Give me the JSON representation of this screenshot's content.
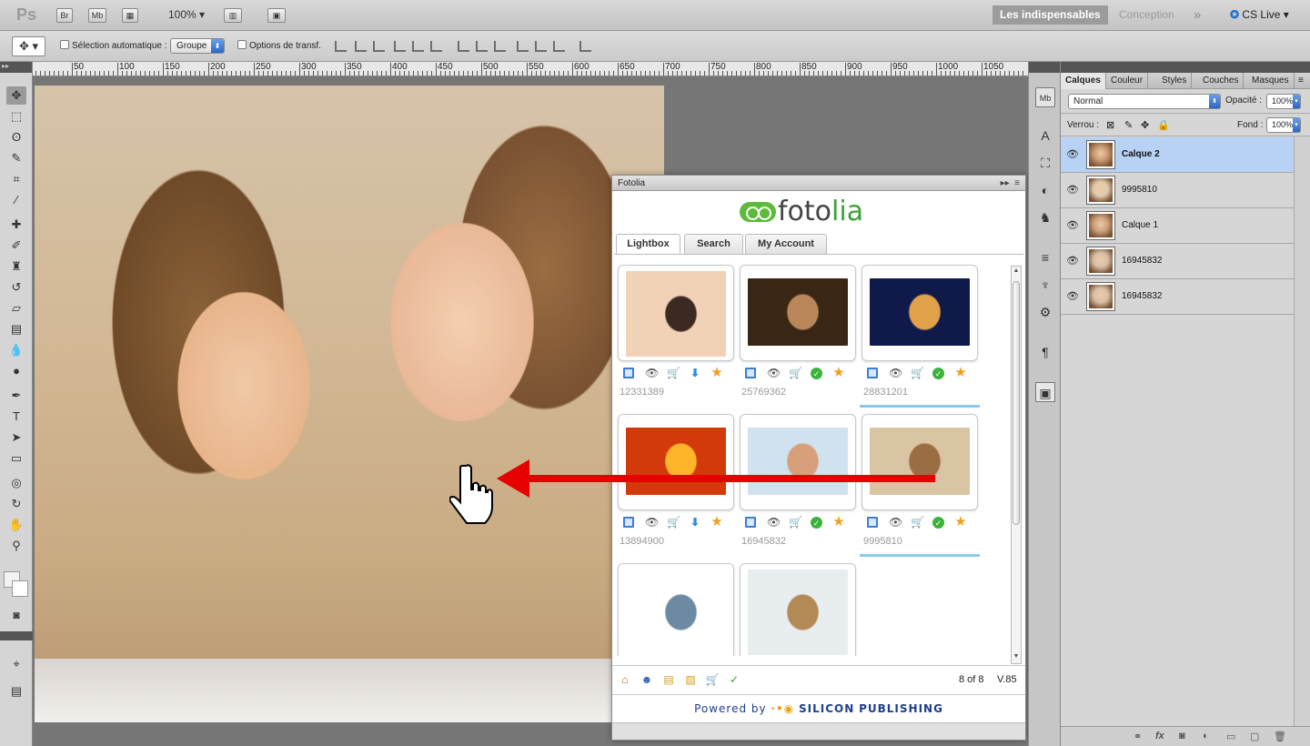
{
  "appbar": {
    "logo": "Ps",
    "br": "Br",
    "mb": "Mb",
    "zoom": "100%",
    "workspace_active": "Les indispensables",
    "workspace_other": "Conception",
    "more": "»",
    "cs_live": "CS Live"
  },
  "options": {
    "auto_select_label": "Sélection automatique :",
    "auto_select_value": "Groupe",
    "transform_label": "Options de transf."
  },
  "ruler": [
    "50",
    "100",
    "150",
    "200",
    "250",
    "300",
    "350",
    "400",
    "450",
    "500",
    "550",
    "600",
    "650",
    "700",
    "750",
    "800",
    "850",
    "900",
    "950",
    "1000",
    "1050"
  ],
  "fotolia": {
    "panel_title": "Fotolia",
    "logo_left": "foto",
    "logo_right": "lia",
    "tabs": [
      "Lightbox",
      "Search",
      "My Account"
    ],
    "items": [
      {
        "id": "12331389",
        "icons": [
          "blue",
          "eye",
          "cart",
          "dl",
          "star"
        ],
        "colors": [
          "#f1d2b6",
          "#3b2a22"
        ],
        "selected": false
      },
      {
        "id": "25769362",
        "icons": [
          "blue",
          "eye",
          "cart",
          "ok",
          "star"
        ],
        "colors": [
          "#3a2614",
          "#b9875a"
        ],
        "selected": false
      },
      {
        "id": "28831201",
        "icons": [
          "blue",
          "eye",
          "cart",
          "ok",
          "star"
        ],
        "colors": [
          "#0f1a4a",
          "#e0a14a"
        ],
        "selected": true
      },
      {
        "id": "13894900",
        "icons": [
          "blue",
          "eye",
          "cart",
          "dl",
          "star"
        ],
        "colors": [
          "#d23a0a",
          "#ffb52a"
        ],
        "selected": false
      },
      {
        "id": "16945832",
        "icons": [
          "blue",
          "eye",
          "cart",
          "ok",
          "star"
        ],
        "colors": [
          "#cfe2ee",
          "#d7a07a"
        ],
        "selected": false
      },
      {
        "id": "9995810",
        "icons": [
          "blue",
          "eye",
          "cart",
          "ok",
          "star"
        ],
        "colors": [
          "#d9c4a4",
          "#9b6d42"
        ],
        "selected": true
      },
      {
        "id": "",
        "icons": [],
        "colors": [
          "#ffffff",
          "#6d8aa3"
        ],
        "selected": false
      },
      {
        "id": "",
        "icons": [],
        "colors": [
          "#e8edf0",
          "#b38a55"
        ],
        "selected": false
      }
    ],
    "page_count": "8 of 8",
    "version": "V.85",
    "powered_by": "Powered by",
    "powered_brand_a": "SILICON",
    "powered_brand_b": "PUBLISHING"
  },
  "layers_panel": {
    "tabs": [
      "Calques",
      "Couleur",
      "Styles",
      "Couches",
      "Masques"
    ],
    "blend_mode": "Normal",
    "opacity_label": "Opacité :",
    "opacity_value": "100%",
    "lock_label": "Verrou :",
    "fill_label": "Fond :",
    "fill_value": "100%",
    "layers": [
      {
        "name": "Calque 2",
        "selected": true
      },
      {
        "name": "9995810",
        "selected": false
      },
      {
        "name": "Calque 1",
        "selected": false
      },
      {
        "name": "16945832",
        "selected": false
      },
      {
        "name": "16945832",
        "selected": false
      }
    ],
    "footer_fx": "fx"
  }
}
